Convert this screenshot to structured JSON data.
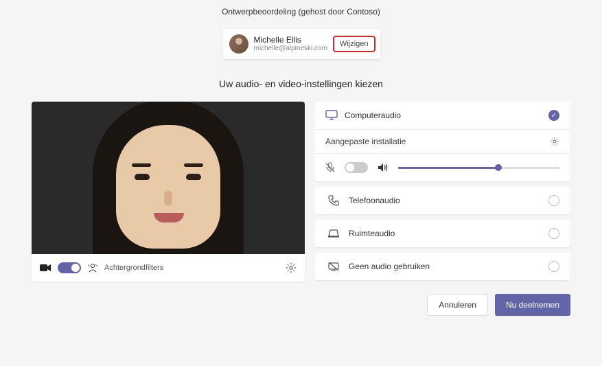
{
  "header": {
    "title": "Ontwerpbeoordeling (gehost door Contoso)"
  },
  "user": {
    "name": "Michelle Ellis",
    "email": "michelle@alpineski.com",
    "change_label": "Wijzigen"
  },
  "subtitle": "Uw audio- en video-instellingen kiezen",
  "video": {
    "bg_filters_label": "Achtergrondfilters"
  },
  "audio": {
    "computer": "Computeraudio",
    "custom_setup": "Aangepaste installatie",
    "phone": "Telefoonaudio",
    "room": "Ruimteaudio",
    "none": "Geen audio gebruiken"
  },
  "footer": {
    "cancel": "Annuleren",
    "join": "Nu deelnemen"
  },
  "colors": {
    "accent": "#6264a7",
    "highlight_border": "#d9262c"
  }
}
